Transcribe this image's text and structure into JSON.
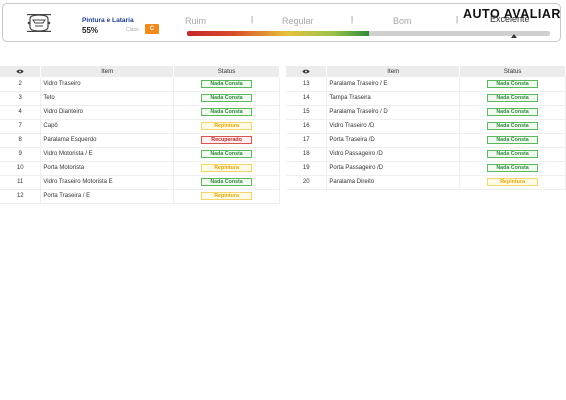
{
  "header": {
    "category_title": "Pintura e Lataria",
    "category_percent": "55%",
    "class_label": "Class.",
    "class_value": "C",
    "scale": [
      "Ruim",
      "Regular",
      "Bom",
      "Excelente"
    ],
    "scale_fill_fraction": 0.5,
    "brand": "AUTO AVALIAR"
  },
  "tables": {
    "headers": {
      "eye": "eye-icon",
      "item": "Item",
      "status": "Status"
    },
    "left": [
      {
        "num": "2",
        "item": "Vidro Traseiro",
        "status": "Nada Consta",
        "kind": "ok"
      },
      {
        "num": "3",
        "item": "Teto",
        "status": "Nada Consta",
        "kind": "ok"
      },
      {
        "num": "4",
        "item": "Vidro Dianteiro",
        "status": "Nada Consta",
        "kind": "ok"
      },
      {
        "num": "7",
        "item": "Capô",
        "status": "Repintura",
        "kind": "rep"
      },
      {
        "num": "8",
        "item": "Paralama Esquerdo",
        "status": "Recuperado",
        "kind": "rec"
      },
      {
        "num": "9",
        "item": "Vidro Motorista / E",
        "status": "Nada Consta",
        "kind": "ok"
      },
      {
        "num": "10",
        "item": "Porta Motorista",
        "status": "Repintura",
        "kind": "rep"
      },
      {
        "num": "11",
        "item": "Vidro Traseiro Motorista E",
        "status": "Nada Consta",
        "kind": "ok"
      },
      {
        "num": "12",
        "item": "Porta Traseira / E",
        "status": "Repintura",
        "kind": "rep"
      }
    ],
    "right": [
      {
        "num": "13",
        "item": "Paralama Traseiro / E",
        "status": "Nada Consta",
        "kind": "ok"
      },
      {
        "num": "14",
        "item": "Tampa Traseira",
        "status": "Nada Consta",
        "kind": "ok"
      },
      {
        "num": "15",
        "item": "Paralama Traseiro / D",
        "status": "Nada Consta",
        "kind": "ok"
      },
      {
        "num": "16",
        "item": "Vidro Traseiro /D",
        "status": "Nada Consta",
        "kind": "ok"
      },
      {
        "num": "17",
        "item": "Porta Traseira /D",
        "status": "Nada Consta",
        "kind": "ok"
      },
      {
        "num": "18",
        "item": "Vidro Passageiro /D",
        "status": "Nada Consta",
        "kind": "ok"
      },
      {
        "num": "19",
        "item": "Porta Passageiro /D",
        "status": "Nada Consta",
        "kind": "ok"
      },
      {
        "num": "20",
        "item": "Paralama Direito",
        "status": "Repintura",
        "kind": "rep"
      }
    ]
  },
  "colors": {
    "ok": "#2e8b3c",
    "repintura": "#e2a700",
    "recuperado": "#c62828",
    "class_badge": "#f08a1c",
    "title": "#1f3a93"
  }
}
